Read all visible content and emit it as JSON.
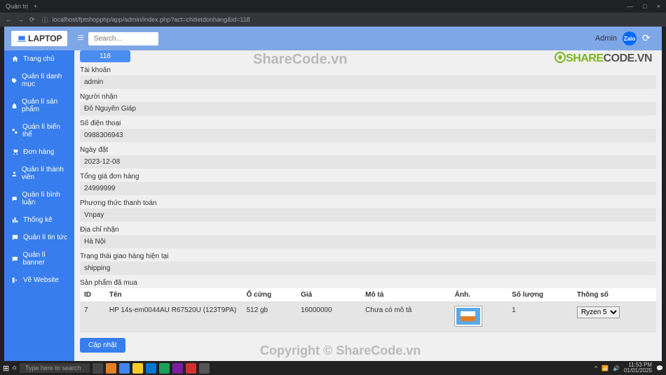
{
  "browser": {
    "tab_title": "Quản trị",
    "url": "localhost/fptshopphp/app/admin/index.php?act=chitietdonhang&id=118",
    "window_controls": {
      "min": "—",
      "max": "□",
      "close": "×"
    }
  },
  "topbar": {
    "logo": "LAPTOP",
    "search_placeholder": "Search...",
    "user": "Admin",
    "zalo": "Zalo"
  },
  "sidebar": {
    "items": [
      {
        "label": "Trang chủ"
      },
      {
        "label": "Quản lí danh mục"
      },
      {
        "label": "Quản lí sản phẩm"
      },
      {
        "label": "Quản lí biến thể"
      },
      {
        "label": "Đơn hàng"
      },
      {
        "label": "Quản lí thành viên"
      },
      {
        "label": "Quản lí bình luận"
      },
      {
        "label": "Thống kê"
      },
      {
        "label": "Quản lí tin tức"
      },
      {
        "label": "Quản lí banner"
      },
      {
        "label": "Về Website"
      }
    ]
  },
  "order": {
    "id": "118",
    "fields": [
      {
        "label": "Tài khoản",
        "value": "admin"
      },
      {
        "label": "Người nhận",
        "value": "Đỗ Nguyên Giáp"
      },
      {
        "label": "Số điện thoại",
        "value": "0988306943"
      },
      {
        "label": "Ngày đặt",
        "value": "2023-12-08"
      },
      {
        "label": "Tổng giá đơn hàng",
        "value": "24999999"
      },
      {
        "label": "Phương thức thanh toán",
        "value": "Vnpay"
      },
      {
        "label": "Địa chỉ nhận",
        "value": "Hà Nội"
      },
      {
        "label": "Trạng thái giao hàng hiện tại",
        "value": "shipping"
      }
    ],
    "products_label": "Sản phẩm đã mua",
    "headers": {
      "id": "ID",
      "name": "Tên",
      "disk": "Ổ cứng",
      "price": "Giá",
      "desc": "Mô tả",
      "img": "Ảnh.",
      "qty": "Số lượng",
      "spec": "Thông số"
    },
    "rows": [
      {
        "id": "7",
        "name": "HP 14s-em0044AU R67520U (123T9PA)",
        "disk": "512 gb",
        "price": "16000000",
        "desc": "Chưa có mô tả",
        "qty": "1",
        "spec": "Ryzen 5"
      }
    ],
    "update_btn": "Cập nhật"
  },
  "watermark": "ShareCode.vn",
  "copyright": "Copyright © ShareCode.vn",
  "sharecode": {
    "s": "SHARE",
    "c": "CODE.VN"
  },
  "taskbar": {
    "search": "Type here to search",
    "time": "11:53 PM",
    "date": "01/01/2025"
  }
}
